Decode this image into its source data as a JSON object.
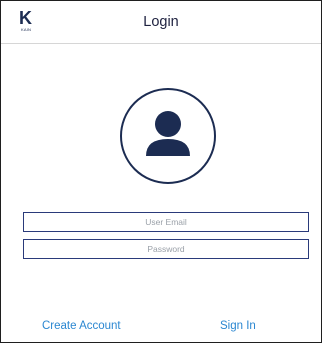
{
  "header": {
    "logo_letter": "K",
    "logo_subtext": "KAIN",
    "title": "Login"
  },
  "avatar": {
    "icon": "user-icon",
    "color": "#1c2c52"
  },
  "form": {
    "email_placeholder": "User Email",
    "email_value": "",
    "password_placeholder": "Password",
    "password_value": ""
  },
  "actions": {
    "create_account_label": "Create Account",
    "sign_in_label": "Sign In"
  },
  "colors": {
    "brand": "#1c2c52",
    "link": "#2b87d1",
    "field_border": "#2a3a7a"
  }
}
